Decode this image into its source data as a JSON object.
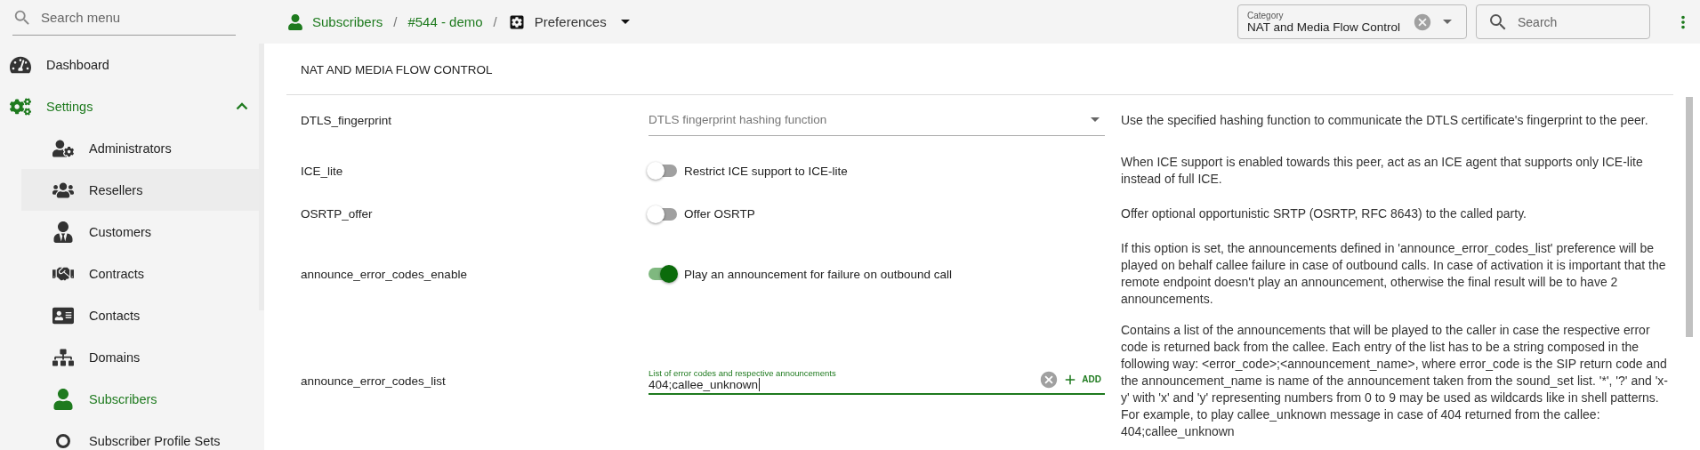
{
  "sidebar": {
    "search": {
      "placeholder": "Search menu"
    },
    "items": [
      {
        "label": "Dashboard",
        "selected": false
      },
      {
        "label": "Settings",
        "selected": true,
        "expanded": true,
        "children": [
          {
            "label": "Administrators",
            "selected": false,
            "highlighted": false
          },
          {
            "label": "Resellers",
            "selected": false,
            "highlighted": true
          },
          {
            "label": "Customers",
            "selected": false,
            "highlighted": false
          },
          {
            "label": "Contracts",
            "selected": false,
            "highlighted": false
          },
          {
            "label": "Contacts",
            "selected": false,
            "highlighted": false
          },
          {
            "label": "Domains",
            "selected": false,
            "highlighted": false
          },
          {
            "label": "Subscribers",
            "selected": true,
            "highlighted": false
          },
          {
            "label": "Subscriber Profile Sets",
            "selected": false,
            "highlighted": false
          }
        ]
      }
    ]
  },
  "breadcrumb": {
    "separator": "/",
    "items": [
      {
        "label": "Subscribers",
        "kind": "link"
      },
      {
        "label": "#544 - demo",
        "kind": "link"
      },
      {
        "label": "Preferences",
        "kind": "menu"
      }
    ]
  },
  "category": {
    "label": "Category",
    "value": "NAT and Media Flow Control"
  },
  "search": {
    "placeholder": "Search"
  },
  "section": {
    "title": "NAT AND MEDIA FLOW CONTROL",
    "rows": [
      {
        "name": "DTLS_fingerprint",
        "kind": "select",
        "placeholder": "DTLS fingerprint hashing function",
        "description": "Use the specified hashing function to communicate the DTLS certificate's fingerprint to the peer."
      },
      {
        "name": "ICE_lite",
        "kind": "toggle",
        "label": "Restrict ICE support to ICE-lite",
        "on": false,
        "description": "When ICE support is enabled towards this peer, act as an ICE agent that supports only ICE-lite instead of full ICE."
      },
      {
        "name": "OSRTP_offer",
        "kind": "toggle",
        "label": "Offer OSRTP",
        "on": false,
        "description": "Offer optional opportunistic SRTP (OSRTP, RFC 8643) to the called party."
      },
      {
        "name": "announce_error_codes_enable",
        "kind": "toggle",
        "label": "Play an announcement for failure on outbound call",
        "on": true,
        "description": "If this option is set, the announcements defined in 'announce_error_codes_list' preference will be played on behalf callee failure in case of outbound calls. In case of activation it is important that the remote endpoint doesn't play an announcement, otherwise the final result will be to have 2 announcements."
      },
      {
        "name": "announce_error_codes_list",
        "kind": "list_input",
        "label": "List of error codes and respective announcements",
        "value": "404;callee_unknown",
        "action": "ADD",
        "description": "Contains a list of the announcements that will be played to the caller in case the respective error code is returned back from the callee. Each entry of the list has to be a string composed in the following way: <error_code>;<announcement_name>, where error_code is the SIP return code and the announcement_name is name of the announcement taken from the sound_set list. '*', '?' and 'x-y' with 'x' and 'y' representing numbers from 0 to 9 may be used as wildcards like in shell patterns. For example, to play callee_unknown message in case of 404 returned from the callee: 404;callee_unknown"
      }
    ]
  }
}
